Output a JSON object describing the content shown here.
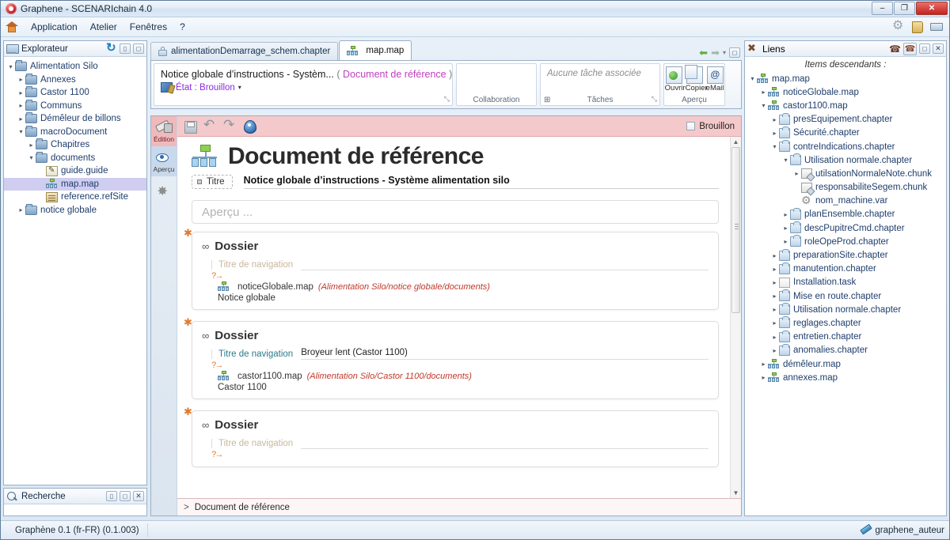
{
  "window": {
    "title": "Graphene - SCENARIchain 4.0",
    "minimize_label": "–",
    "maximize_label": "❐",
    "close_label": "✕"
  },
  "menubar": {
    "home_icon": "home-icon",
    "items": [
      "Application",
      "Atelier",
      "Fenêtres",
      "?"
    ],
    "right_icons": [
      "gear-icon",
      "bookmark-icon",
      "print-preview-icon"
    ]
  },
  "explorer": {
    "title": "Explorateur",
    "icon": "explorer-icon",
    "buttons": [
      "refresh-icon",
      "minimize-panel-icon",
      "maximize-panel-icon"
    ],
    "tree": [
      {
        "label": "Alimentation Silo",
        "depth": 0,
        "arrow": "down",
        "icon": "folder",
        "selected": false
      },
      {
        "label": "Annexes",
        "depth": 1,
        "arrow": "right",
        "icon": "folder",
        "selected": false
      },
      {
        "label": "Castor 1100",
        "depth": 1,
        "arrow": "right",
        "icon": "folder",
        "selected": false
      },
      {
        "label": "Communs",
        "depth": 1,
        "arrow": "right",
        "icon": "folder",
        "selected": false
      },
      {
        "label": "Démêleur de billons",
        "depth": 1,
        "arrow": "right",
        "icon": "folder",
        "selected": false
      },
      {
        "label": "macroDocument",
        "depth": 1,
        "arrow": "down",
        "icon": "folder",
        "selected": false
      },
      {
        "label": "Chapitres",
        "depth": 2,
        "arrow": "right",
        "icon": "folder",
        "selected": false
      },
      {
        "label": "documents",
        "depth": 2,
        "arrow": "down",
        "icon": "folder",
        "selected": false
      },
      {
        "label": "guide.guide",
        "depth": 3,
        "arrow": "none",
        "icon": "guide",
        "selected": false
      },
      {
        "label": "map.map",
        "depth": 3,
        "arrow": "none",
        "icon": "map",
        "selected": true
      },
      {
        "label": "reference.refSite",
        "depth": 3,
        "arrow": "none",
        "icon": "refsite",
        "selected": false
      },
      {
        "label": "notice globale",
        "depth": 1,
        "arrow": "right",
        "icon": "folder",
        "selected": false
      }
    ]
  },
  "search_panel": {
    "title": "Recherche",
    "icon": "search-icon",
    "buttons": [
      "minimize-panel-icon",
      "restore-panel-icon",
      "close-panel-icon"
    ]
  },
  "tabs": [
    {
      "label": "alimentationDemarrage_schem.chapter",
      "icon": "lock-icon",
      "active": false
    },
    {
      "label": "map.map",
      "icon": "map-icon",
      "active": true
    }
  ],
  "tabnav": {
    "back_icon": "arrow-left-icon",
    "forward_icon": "arrow-right-icon",
    "dropdown_icon": "chevron-down-icon",
    "restore_icon": "restore-panel-icon"
  },
  "ribbon": {
    "document_title": "Notice globale d’instructions - Systèm...",
    "document_kind_open": "(",
    "document_kind": "Document de référence",
    "document_kind_close": ")",
    "etat_label": "État : Brouillon",
    "etat_icon": "status-icon",
    "etat_caret": "▾",
    "collaboration_label": "Collaboration",
    "tasks_placeholder": "Aucune tâche associée",
    "tasks_label": "Tâches",
    "tasks_icon": "task-link-icon",
    "apercu_label": "Aperçu",
    "apercu_buttons": [
      {
        "label": "Ouvrir",
        "icon": "open-preview-icon"
      },
      {
        "label": "Copier",
        "icon": "copy-icon"
      },
      {
        "label": "eMail",
        "icon": "email-icon"
      }
    ],
    "expander": "⤡"
  },
  "editor": {
    "vtabs": [
      {
        "label": "Édition",
        "icon": "edition-icon",
        "active": true
      },
      {
        "label": "Aperçu",
        "icon": "preview-icon",
        "active": false
      },
      {
        "label": "",
        "icon": "gear-icon",
        "active": false
      }
    ],
    "toolbar_icons": [
      "save-icon",
      "undo-icon",
      "redo-icon",
      "info-icon"
    ],
    "brouillon_label": "Brouillon",
    "heading": "Document de référence",
    "heading_icon": "map-icon",
    "titre_tag": "Titre",
    "titre_value": "Notice globale d’instructions - Système alimentation silo",
    "apercu_placeholder": "Aperçu ...",
    "nav_placeholder": "Titre de navigation",
    "query_marker": "?→",
    "blocks": [
      {
        "title": "Dossier",
        "nav_title": "",
        "link_name": "noticeGlobale.map",
        "link_path": "(Alimentation Silo/notice globale/documents)",
        "link_sub": "Notice globale"
      },
      {
        "title": "Dossier",
        "nav_title": "Broyeur lent (Castor 1100)",
        "link_name": "castor1100.map",
        "link_path": "(Alimentation Silo/Castor 1100/documents)",
        "link_sub": "Castor 1100"
      },
      {
        "title": "Dossier",
        "nav_title": "",
        "link_name": "",
        "link_path": "",
        "link_sub": ""
      }
    ],
    "breadcrumb_marker": ">",
    "breadcrumb": "Document de référence"
  },
  "liens": {
    "title": "Liens",
    "icon": "links-icon",
    "subtitle": "Items descendants :",
    "buttons": [
      "incoming-links-icon",
      "outgoing-links-icon",
      "restore-panel-icon",
      "close-panel-icon"
    ],
    "tree": [
      {
        "label": "map.map",
        "depth": 0,
        "arrow": "down",
        "icon": "map"
      },
      {
        "label": "noticeGlobale.map",
        "depth": 1,
        "arrow": "right",
        "icon": "map"
      },
      {
        "label": "castor1100.map",
        "depth": 1,
        "arrow": "down",
        "icon": "map"
      },
      {
        "label": "presEquipement.chapter",
        "depth": 2,
        "arrow": "right",
        "icon": "chapter"
      },
      {
        "label": "Sécurité.chapter",
        "depth": 2,
        "arrow": "right",
        "icon": "chapter"
      },
      {
        "label": "contreIndications.chapter",
        "depth": 2,
        "arrow": "down",
        "icon": "chapter"
      },
      {
        "label": "Utilisation normale.chapter",
        "depth": 3,
        "arrow": "down",
        "icon": "chapter"
      },
      {
        "label": "utilsationNormaleNote.chunk",
        "depth": 4,
        "arrow": "right",
        "icon": "chunk"
      },
      {
        "label": "responsabiliteSegem.chunk",
        "depth": 4,
        "arrow": "none",
        "icon": "chunk"
      },
      {
        "label": "nom_machine.var",
        "depth": 4,
        "arrow": "none",
        "icon": "var"
      },
      {
        "label": "planEnsemble.chapter",
        "depth": 3,
        "arrow": "right",
        "icon": "chapter"
      },
      {
        "label": "descPupitreCmd.chapter",
        "depth": 3,
        "arrow": "right",
        "icon": "chapter"
      },
      {
        "label": "roleOpeProd.chapter",
        "depth": 3,
        "arrow": "right",
        "icon": "chapter"
      },
      {
        "label": "preparationSite.chapter",
        "depth": 2,
        "arrow": "right",
        "icon": "chapter"
      },
      {
        "label": "manutention.chapter",
        "depth": 2,
        "arrow": "right",
        "icon": "chapter"
      },
      {
        "label": "Installation.task",
        "depth": 2,
        "arrow": "right",
        "icon": "task"
      },
      {
        "label": "Mise en route.chapter",
        "depth": 2,
        "arrow": "right",
        "icon": "chapter"
      },
      {
        "label": "Utilisation normale.chapter",
        "depth": 2,
        "arrow": "right",
        "icon": "chapter"
      },
      {
        "label": "reglages.chapter",
        "depth": 2,
        "arrow": "right",
        "icon": "chapter"
      },
      {
        "label": "entretien.chapter",
        "depth": 2,
        "arrow": "right",
        "icon": "chapter"
      },
      {
        "label": "anomalies.chapter",
        "depth": 2,
        "arrow": "right",
        "icon": "chapter"
      },
      {
        "label": "démêleur.map",
        "depth": 1,
        "arrow": "right",
        "icon": "map"
      },
      {
        "label": "annexes.map",
        "depth": 1,
        "arrow": "right",
        "icon": "map"
      }
    ]
  },
  "statusbar": {
    "left": "Graphène 0.1 (fr-FR) (0.1.003)",
    "user": "graphene_auteur",
    "user_icon": "pen-icon"
  },
  "colors": {
    "accent_pink": "#f4c9cb",
    "selection": "#cfcdf0",
    "link_text": "#1f3d6b",
    "path_red": "#c0392b",
    "magenta": "#c03fc0",
    "purple": "#8a2be2",
    "orange": "#e07a2f"
  }
}
